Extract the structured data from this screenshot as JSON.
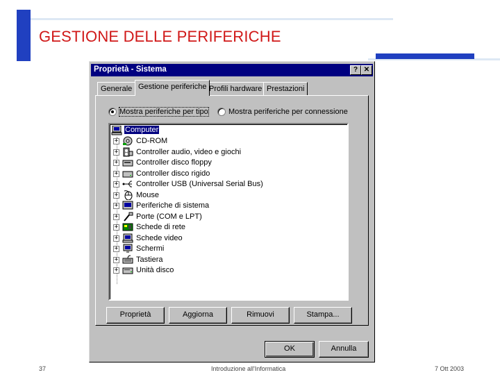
{
  "slide": {
    "title": "GESTIONE DELLE PERIFERICHE",
    "footer_page": "37",
    "footer_course": "Introduzione all'Informatica",
    "footer_date": "7 Ott 2003"
  },
  "window": {
    "title": "Proprietà - Sistema",
    "help_glyph": "?",
    "close_glyph": "✕"
  },
  "tabs": [
    "Generale",
    "Gestione periferiche",
    "Profili hardware",
    "Prestazioni"
  ],
  "view_options": {
    "by_type": "Mostra periferiche per tipo",
    "by_connection": "Mostra periferiche per connessione",
    "selected": "by_type"
  },
  "tree": {
    "root": "Computer",
    "expander_glyph": "+",
    "items": [
      {
        "label": "CD-ROM",
        "icon": "cdrom-icon"
      },
      {
        "label": "Controller audio, video e giochi",
        "icon": "audio-controller-icon"
      },
      {
        "label": "Controller disco floppy",
        "icon": "floppy-controller-icon"
      },
      {
        "label": "Controller disco rigido",
        "icon": "hard-disk-controller-icon"
      },
      {
        "label": "Controller USB (Universal Serial Bus)",
        "icon": "usb-icon"
      },
      {
        "label": "Mouse",
        "icon": "mouse-icon"
      },
      {
        "label": "Periferiche di sistema",
        "icon": "system-device-icon"
      },
      {
        "label": "Porte (COM e LPT)",
        "icon": "port-icon"
      },
      {
        "label": "Schede di rete",
        "icon": "network-card-icon"
      },
      {
        "label": "Schede video",
        "icon": "display-adapter-icon"
      },
      {
        "label": "Schermi",
        "icon": "monitor-icon"
      },
      {
        "label": "Tastiera",
        "icon": "keyboard-icon"
      },
      {
        "label": "Unità disco",
        "icon": "disk-drive-icon"
      }
    ]
  },
  "actions": {
    "properties": "Proprietà",
    "refresh": "Aggiorna",
    "remove": "Rimuovi",
    "print": "Stampa..."
  },
  "footer_buttons": {
    "ok": "OK",
    "cancel": "Annulla"
  },
  "colors": {
    "title_red": "#d01818",
    "accent_blue": "#2040c0",
    "titlebar_navy": "#000080",
    "dialog_gray": "#c0c0c0"
  }
}
